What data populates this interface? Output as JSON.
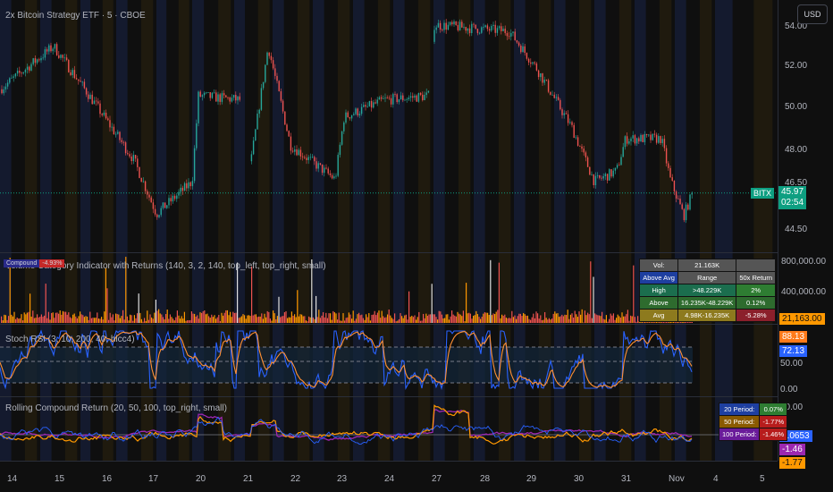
{
  "header": {
    "title": "2x Bitcoin Strategy ETF · 5 · CBOE",
    "currency": "USD"
  },
  "price_axis": {
    "ticks": [
      "54.00",
      "52.00",
      "50.00",
      "48.00",
      "46.50",
      "44.50"
    ],
    "symbol": "BITX",
    "last_price": "45.97",
    "countdown": "02:54"
  },
  "price_path": [
    [
      0,
      50.8
    ],
    [
      60,
      52.8
    ],
    [
      100,
      50.5
    ],
    [
      150,
      47.5
    ],
    [
      175,
      45.0
    ],
    [
      215,
      46.5
    ],
    [
      222,
      50.5
    ],
    [
      270,
      50.3
    ],
    [
      280,
      47.2
    ],
    [
      300,
      52.8
    ],
    [
      325,
      48.2
    ],
    [
      375,
      46.6
    ],
    [
      385,
      49.5
    ],
    [
      430,
      50.3
    ],
    [
      480,
      50.5
    ],
    [
      485,
      53.8
    ],
    [
      570,
      53.5
    ],
    [
      600,
      51.8
    ],
    [
      640,
      49
    ],
    [
      665,
      46.5
    ],
    [
      690,
      47
    ],
    [
      700,
      48.5
    ],
    [
      740,
      48.5
    ],
    [
      750,
      46.6
    ],
    [
      765,
      44.9
    ],
    [
      775,
      46
    ]
  ],
  "volume": {
    "title": "Volume Category Indicator with Returns (140, 3, 2, 140, top_left, top_right, small)",
    "compound_label": "Compound",
    "compound_value": "-4.93%",
    "axis": [
      "800,000.00",
      "400,000.00"
    ],
    "last": "21,163.00",
    "table": {
      "header": [
        "Vol:",
        "21.163K",
        ""
      ],
      "rows": [
        [
          "Above Avg",
          "Range",
          "50x Return"
        ],
        [
          "High",
          ">48.229K",
          "2%"
        ],
        [
          "Above",
          "16.235K-48.229K",
          "0.12%"
        ],
        [
          "Avg",
          "4.98K-16.235K",
          "-5.28%"
        ]
      ]
    }
  },
  "stoch": {
    "title": "Stoch RSI (3, 10, 200, 40, hlcc4)",
    "k": "88.13",
    "d": "72.13",
    "axis": [
      "50.00",
      "0.00"
    ]
  },
  "returns": {
    "title": "Rolling Compound Return (20, 50, 100, top_right, small)",
    "axis": [
      "10.00"
    ],
    "v1": "0.0653",
    "v2": "-1.46",
    "v3": "-1.77",
    "table": [
      {
        "label": "20 Period:",
        "value": "0.07%"
      },
      {
        "label": "50 Period:",
        "value": "-1.77%"
      },
      {
        "label": "100 Period:",
        "value": "-1.46%"
      }
    ]
  },
  "time_axis": [
    "14",
    "15",
    "16",
    "17",
    "20",
    "21",
    "22",
    "23",
    "24",
    "27",
    "28",
    "29",
    "30",
    "31",
    "Nov",
    "4",
    "5"
  ],
  "colors": {
    "up": "#26a69a",
    "down": "#ef5350",
    "stochK": "#ff9033",
    "stochD": "#2962ff",
    "r20": "#2962ff",
    "r50": "#ff9800",
    "r100": "#9c27b0"
  }
}
